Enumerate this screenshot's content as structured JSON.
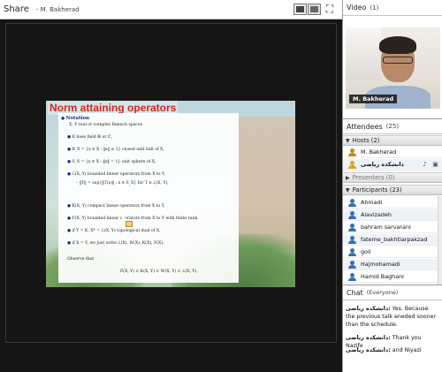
{
  "share": {
    "title": "Share",
    "presenter": "- M. Bakherad",
    "layout_buttons": [
      "layout-1-icon",
      "layout-2-icon"
    ],
    "fullscreen_icon": "fullscreen-icon"
  },
  "slide": {
    "title": "Norm attaining operators",
    "notation_heading": "Notation",
    "lines": [
      "X, Y real or complex Banach spaces",
      "K base field ℝ or ℂ,",
      "B_X = {x ∈ X : ‖x‖ ≤ 1} closed unit ball of X,",
      "S_X = {x ∈ X : ‖x‖ = 1} unit sphere of X,",
      "ℒ(X, Y) bounded linear operators from X to Y,",
      "‖T‖ = sup{‖T(x)‖ : x ∈ S_X} for T ∈ ℒ(X, Y),",
      "K(X, Y) compact linear operators from X to Y,",
      "F(X, Y) bounded linear operators from X to Y with finite rank,",
      "if Y = K, X* = ℒ(X, Y) topological dual of X,",
      "if X = Y, we just write ℒ(X), W(X), K(X), F(X).",
      "Observe that",
      "F(X, Y) ⊂ K(X, Y) ⊂ W(X, Y) ⊂ ℒ(X, Y)."
    ]
  },
  "video": {
    "title": "Video",
    "count": "(1)",
    "participant_name": "M. Bakherad"
  },
  "attendees": {
    "title": "Attendees",
    "count": "(25)",
    "hosts_label": "Hosts (2)",
    "hosts": [
      {
        "name": "M. Bakherad",
        "icon": "host-icon"
      },
      {
        "name": "دانشکده ریاضی",
        "icon": "host-icon"
      }
    ],
    "presenters_label": "Presenters (0)",
    "participants_label": "Participants (23)",
    "participants": [
      {
        "name": "Ahmadi"
      },
      {
        "name": "Alavizadeh"
      },
      {
        "name": "bahram sarvarani"
      },
      {
        "name": "fateme_bakhtiarpakzad"
      },
      {
        "name": "goli"
      },
      {
        "name": "Hajmohamadi"
      },
      {
        "name": "Hamid Baghani"
      }
    ]
  },
  "chat": {
    "title": "Chat",
    "scope": "(Everyone)",
    "messages": [
      {
        "sender": "دانشکده ریاضی:",
        "text": "Yes. Because the previous talk eneded sooner than the schedule."
      },
      {
        "sender": "دانشکده ریاضی:",
        "text": "Thank you Nazife"
      },
      {
        "sender": "دانشکده ریاضی:",
        "text": "and Niyazi"
      }
    ]
  },
  "colors": {
    "share_background": "#151515",
    "slide_title": "#d8261a",
    "notation_heading": "#1a2f80",
    "host_icon": "#c48a1c",
    "participant_icon": "#3b6fb4"
  }
}
